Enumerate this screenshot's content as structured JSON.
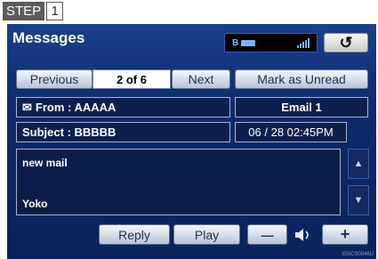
{
  "step": {
    "word": "STEP",
    "number": "1"
  },
  "app": {
    "title": "Messages"
  },
  "status": {
    "bt": "B",
    "signal_icon": "signal-icon"
  },
  "nav": {
    "previous": "Previous",
    "page": "2 of 6",
    "next": "Next",
    "mark_unread": "Mark as Unread"
  },
  "message": {
    "from": "From : AAAAA",
    "account": "Email 1",
    "subject": "Subject : BBBBB",
    "date": "06 / 28  02:45PM",
    "body_line1": "new mail",
    "body_line2": "Yoko"
  },
  "actions": {
    "reply": "Reply",
    "play": "Play",
    "minus": "—",
    "plus": "+"
  },
  "image_code": "ISSCS0046U"
}
